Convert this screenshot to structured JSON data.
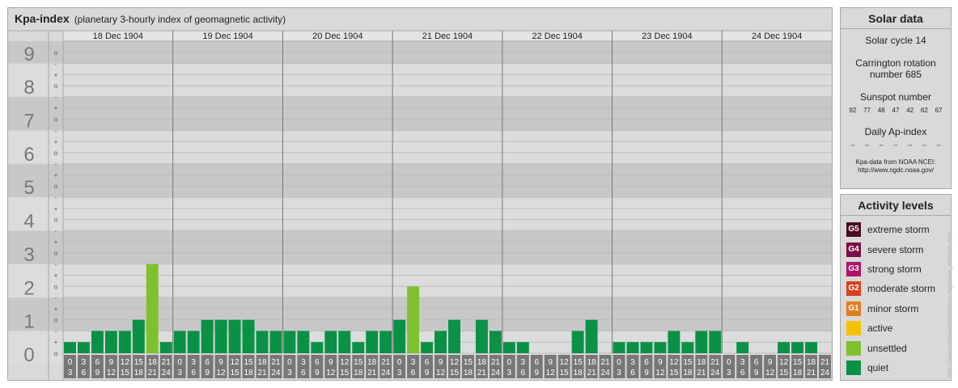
{
  "header": {
    "title": "Kpa-index",
    "subtitle": "(planetary 3-hourly index of geomagnetic activity)"
  },
  "chart_data": {
    "type": "bar",
    "title": "Kpa-index",
    "subtitle": "(planetary 3-hourly index of geomagnetic activity)",
    "days": [
      "18 Dec 1904",
      "19 Dec 1904",
      "20 Dec 1904",
      "21 Dec 1904",
      "22 Dec 1904",
      "23 Dec 1904",
      "24 Dec 1904"
    ],
    "hour_ranges": [
      [
        "0",
        "3"
      ],
      [
        "3",
        "6"
      ],
      [
        "6",
        "9"
      ],
      [
        "9",
        "12"
      ],
      [
        "12",
        "15"
      ],
      [
        "15",
        "18"
      ],
      [
        "18",
        "21"
      ],
      [
        "21",
        "24"
      ]
    ],
    "y_ticks": [
      "0",
      "1",
      "2",
      "3",
      "4",
      "5",
      "6",
      "7",
      "8",
      "9"
    ],
    "sub_ticks": [
      "o",
      "-",
      "+"
    ],
    "ylim": [
      0,
      9.333
    ],
    "values": [
      0.333,
      0.333,
      0.667,
      0.667,
      0.667,
      1.0,
      2.667,
      0.333,
      0.667,
      0.667,
      1.0,
      1.0,
      1.0,
      1.0,
      0.667,
      0.667,
      0.667,
      0.667,
      0.333,
      0.667,
      0.667,
      0.333,
      0.667,
      0.667,
      1.0,
      2.0,
      0.333,
      0.667,
      1.0,
      0.0,
      1.0,
      0.667,
      0.333,
      0.333,
      0.0,
      0.0,
      0.0,
      0.667,
      1.0,
      0.0,
      0.333,
      0.333,
      0.333,
      0.333,
      0.667,
      0.333,
      0.667,
      0.667,
      0.0,
      0.333,
      0.0,
      0.0,
      0.333,
      0.333,
      0.333,
      0.0
    ],
    "colors": {
      "quiet": "#0a9146",
      "unsettled": "#7ec12d"
    },
    "grid": true
  },
  "solar": {
    "title": "Solar data",
    "cycle": "Solar cycle 14",
    "carrington_line1": "Carrington rotation",
    "carrington_line2": "number 685",
    "sunspot_title": "Sunspot number",
    "sunspots": [
      "92",
      "77",
      "48",
      "47",
      "42",
      "62",
      "67"
    ],
    "ap_title": "Daily Ap-index",
    "ap": [
      "--",
      "--",
      "--",
      "--",
      "--",
      "--",
      "--"
    ],
    "source_line1": "Kpa-data from NOAA NCEI:",
    "source_line2": "http://www.ngdc.noaa.gov/"
  },
  "activity": {
    "title": "Activity levels",
    "levels": [
      {
        "code": "G5",
        "label": "extreme storm",
        "color": "#4d0924"
      },
      {
        "code": "G4",
        "label": "severe storm",
        "color": "#7c0c45"
      },
      {
        "code": "G3",
        "label": "strong storm",
        "color": "#b0136b"
      },
      {
        "code": "G2",
        "label": "moderate storm",
        "color": "#d8411c"
      },
      {
        "code": "G1",
        "label": "minor storm",
        "color": "#e37b1f"
      },
      {
        "code": "",
        "label": "active",
        "color": "#f6c200"
      },
      {
        "code": "",
        "label": "unsettled",
        "color": "#7ec12d"
      },
      {
        "code": "",
        "label": "quiet",
        "color": "#0a9146"
      }
    ]
  },
  "watermark": "http://www.theweatherforum.org/www_archive.php"
}
